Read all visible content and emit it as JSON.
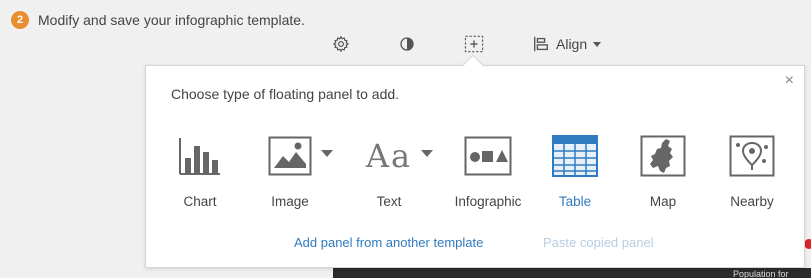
{
  "step": {
    "number": "2",
    "title": "Modify and save your infographic template."
  },
  "toolbar": {
    "items": [
      {
        "name": "settings",
        "icon": "gear-icon"
      },
      {
        "name": "theme",
        "icon": "contrast-icon"
      },
      {
        "name": "add-panel",
        "icon": "add-panel-icon"
      }
    ],
    "align_label": "Align"
  },
  "panel": {
    "heading": "Choose type of floating panel to add.",
    "close_symbol": "×",
    "options": [
      {
        "label": "Chart",
        "icon": "bar-chart-icon",
        "has_dropdown": false,
        "selected": false
      },
      {
        "label": "Image",
        "icon": "image-icon",
        "has_dropdown": true,
        "selected": false
      },
      {
        "label": "Text",
        "icon": "text-aa-icon",
        "icon_text": "Aa",
        "has_dropdown": true,
        "selected": false
      },
      {
        "label": "Infographic",
        "icon": "infographic-icon",
        "has_dropdown": false,
        "selected": false
      },
      {
        "label": "Table",
        "icon": "table-icon",
        "has_dropdown": false,
        "selected": true
      },
      {
        "label": "Map",
        "icon": "map-icon",
        "has_dropdown": false,
        "selected": false
      },
      {
        "label": "Nearby",
        "icon": "nearby-icon",
        "has_dropdown": false,
        "selected": false
      }
    ],
    "links": {
      "add_from_template": "Add panel from another template",
      "paste_copied": "Paste copied panel"
    }
  },
  "background": {
    "partial_text": "Population for"
  },
  "colors": {
    "accent": "#2f7bbf",
    "step_badge": "#e98d32",
    "icon_gray": "#666666",
    "disabled_link": "#b8cde0"
  }
}
